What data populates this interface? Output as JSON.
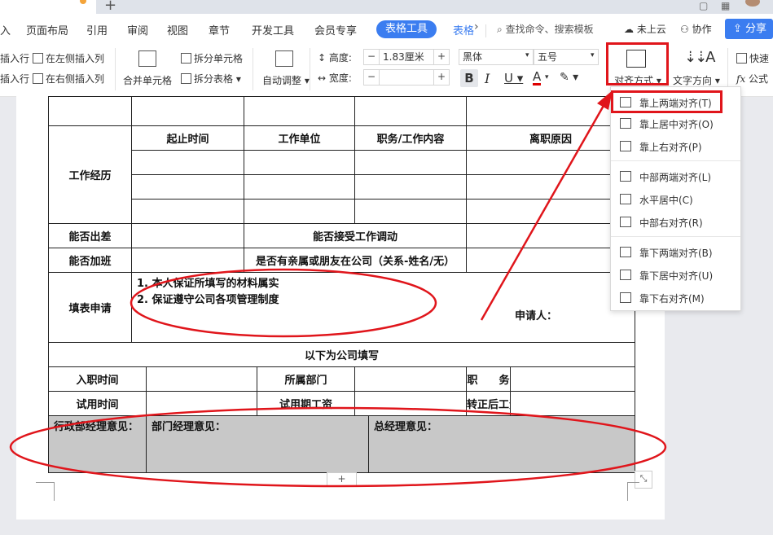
{
  "menu": {
    "partial": "入",
    "items": [
      "页面布局",
      "引用",
      "审阅",
      "视图",
      "章节",
      "开发工具",
      "会员专享"
    ],
    "active_tab": "表格工具",
    "next_tab": "表格",
    "search": "查找命令、搜索模板",
    "cloud": "未上云",
    "collab": "协作",
    "share": "分享"
  },
  "toolbar": {
    "insert_above": "插入行",
    "insert_below": "插入行",
    "insert_left": "在左侧插入列",
    "insert_right": "在右侧插入列",
    "merge": "合并单元格",
    "split_cell": "拆分单元格",
    "split_table": "拆分表格",
    "autofit": "自动调整",
    "height_label": "高度:",
    "height_value": "1.83厘米",
    "width_label": "宽度:",
    "font": "黑体",
    "size": "五号",
    "align_btn": "对齐方式",
    "text_dir": "文字方向",
    "quick_calc": "快速",
    "formula": "公式"
  },
  "dropdown": {
    "items": [
      "靠上两端对齐(T)",
      "靠上居中对齐(O)",
      "靠上右对齐(P)",
      "中部两端对齐(L)",
      "水平居中(C)",
      "中部右对齐(R)",
      "靠下两端对齐(B)",
      "靠下居中对齐(U)",
      "靠下右对齐(M)"
    ]
  },
  "form": {
    "work_history": "工作经历",
    "col_time": "起止时间",
    "col_unit": "工作单位",
    "col_duty": "职务/工作内容",
    "col_reason": "离职原因",
    "travel": "能否出差",
    "transfer": "能否接受工作调动",
    "overtime": "能否加班",
    "relatives": "是否有亲属或朋友在公司（关系-姓名/无）",
    "apply": "填表申请",
    "pledge1": "1.  本人保证所填写的材料属实",
    "pledge2": "2.  保证遵守公司各项管理制度",
    "applicant": "申请人：",
    "company_fill": "以下为公司填写",
    "entry_time": "入职时间",
    "dept": "所属部门",
    "position": "职　　务",
    "trial_time": "试用时间",
    "trial_salary": "试用期工资",
    "regular_salary": "转正后工资",
    "admin_opinion": "行政部经理意见：",
    "dept_opinion": "部门经理意见：",
    "gm_opinion": "总经理意见："
  },
  "colors": {
    "accent": "#3b7df0",
    "annotation": "#e0151b",
    "gray_cell": "#c8c8c8"
  }
}
